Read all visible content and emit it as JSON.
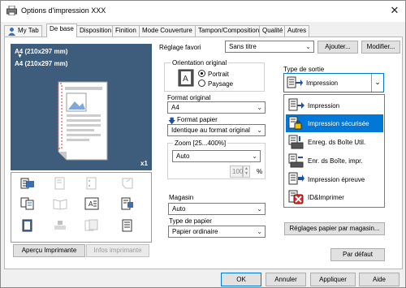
{
  "window": {
    "title": "Options d'impression XXX"
  },
  "tabs": [
    "My Tab",
    "De base",
    "Disposition",
    "Finition",
    "Mode Couverture",
    "Tampon/Composition",
    "Qualité",
    "Autres"
  ],
  "preview": {
    "paper1": "A4 (210x297 mm)",
    "paper2": "A4 (210x297 mm)",
    "copies": "x1"
  },
  "left_buttons": {
    "printer_view": "Aperçu Imprimante",
    "printer_info": "Infos imprimante"
  },
  "favorite": {
    "label": "Réglage favori",
    "value": "Sans titre",
    "add": "Ajouter...",
    "modify": "Modifier..."
  },
  "orientation": {
    "label": "Orientation original",
    "portrait": "Portrait",
    "landscape": "Paysage",
    "selected": "Portrait"
  },
  "original_format": {
    "label": "Format original",
    "value": "A4"
  },
  "paper_format": {
    "label": "Format papier",
    "value": "Identique au format original"
  },
  "zoom": {
    "label": "Zoom [25...400%]",
    "value": "Auto",
    "percent_value": "100",
    "unit": "%"
  },
  "magasin": {
    "label": "Magasin",
    "value": "Auto"
  },
  "paper_type": {
    "label": "Type de papier",
    "value": "Papier ordinaire"
  },
  "output": {
    "label": "Type de sortie",
    "value": "Impression",
    "options": [
      "Impression",
      "Impression sécurisée",
      "Enreg. ds Boîte Util.",
      "Enr. ds Boîte, impr.",
      "Impression épreuve",
      "ID&Imprimer"
    ],
    "highlighted": "Impression sécurisée"
  },
  "paper_settings_button": "Réglages papier par magasin...",
  "default_button": "Par défaut",
  "footer": {
    "ok": "OK",
    "cancel": "Annuler",
    "apply": "Appliquer",
    "help": "Aide"
  }
}
